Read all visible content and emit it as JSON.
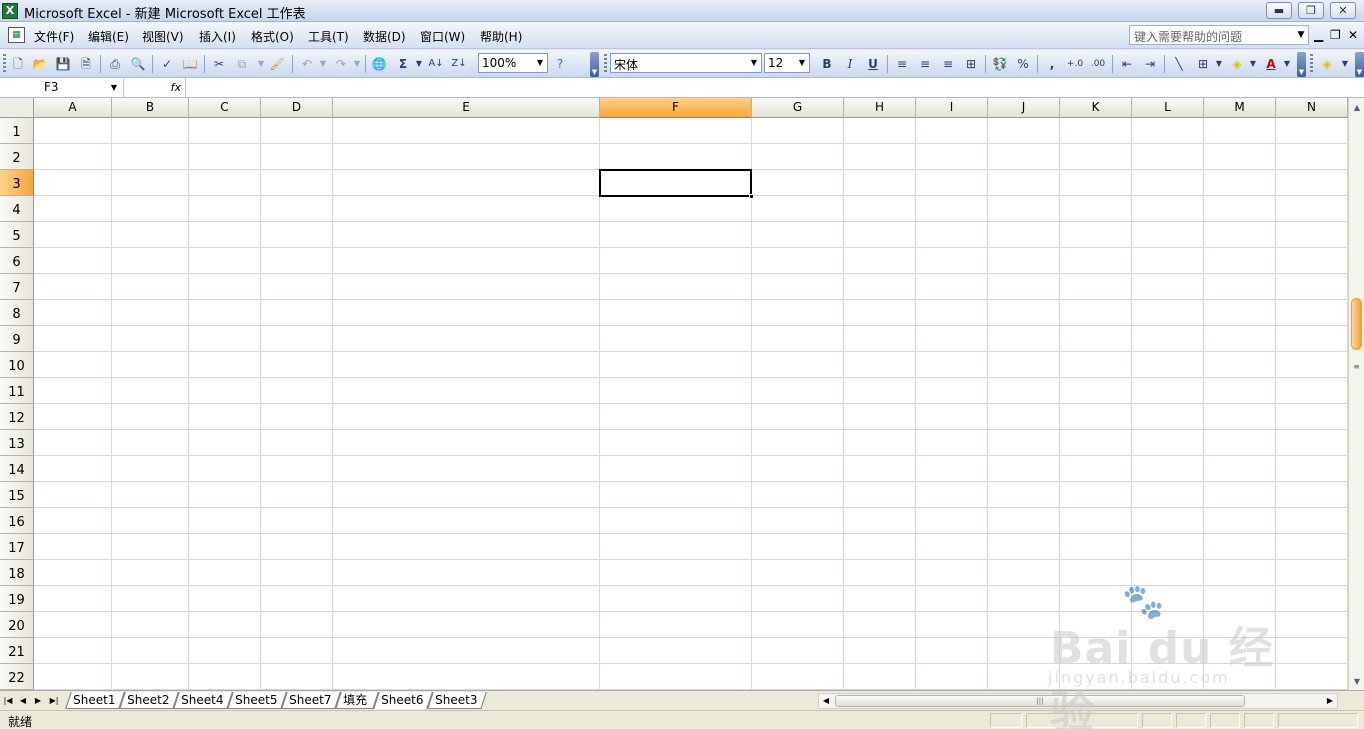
{
  "window": {
    "title": "Microsoft Excel - 新建 Microsoft Excel 工作表",
    "minimize": "▬",
    "restore": "❐",
    "close": "✕"
  },
  "menu": [
    {
      "label": "文件(F)"
    },
    {
      "label": "编辑(E)"
    },
    {
      "label": "视图(V)"
    },
    {
      "label": "插入(I)"
    },
    {
      "label": "格式(O)"
    },
    {
      "label": "工具(T)"
    },
    {
      "label": "数据(D)"
    },
    {
      "label": "窗口(W)"
    },
    {
      "label": "帮助(H)"
    }
  ],
  "help": {
    "placeholder": "键入需要帮助的问题"
  },
  "toolbar": {
    "zoom": "100%",
    "font_name": "宋体",
    "font_size": "12",
    "bold": "B",
    "italic": "I",
    "underline": "U",
    "percent": "%",
    "comma": ",",
    "sum": "Σ"
  },
  "formula_bar": {
    "name_box": "F3",
    "fx": "fx",
    "value": ""
  },
  "grid": {
    "columns": [
      "A",
      "B",
      "C",
      "D",
      "E",
      "F",
      "G",
      "H",
      "I",
      "J",
      "K",
      "L",
      "M",
      "N"
    ],
    "rows": [
      "1",
      "2",
      "3",
      "4",
      "5",
      "6",
      "7",
      "8",
      "9",
      "10",
      "11",
      "12",
      "13",
      "14",
      "15",
      "16",
      "17",
      "18",
      "19",
      "20",
      "21",
      "22"
    ],
    "active_column": "F",
    "active_row": "3"
  },
  "sheets": [
    {
      "label": "Sheet1"
    },
    {
      "label": "Sheet2"
    },
    {
      "label": "Sheet4"
    },
    {
      "label": "Sheet5"
    },
    {
      "label": "Sheet7"
    },
    {
      "label": "填充"
    },
    {
      "label": "Sheet6",
      "active": true
    },
    {
      "label": "Sheet3"
    }
  ],
  "status": {
    "text": "就绪"
  },
  "watermark": {
    "brand": "Bai du 经验",
    "url": "jingyan.baidu.com"
  }
}
